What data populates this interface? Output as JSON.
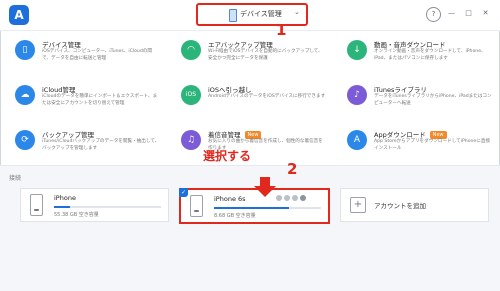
{
  "app": {
    "logo_letter": "A"
  },
  "header": {
    "device_selector_label": "デバイス管理"
  },
  "window_buttons": [
    "?",
    "—",
    "□",
    "✕"
  ],
  "annotations": {
    "step1": "1",
    "step2": "2",
    "select_text": "選択する"
  },
  "features": [
    {
      "title": "デバイス管理",
      "desc": "iOSデバイス、コンピューター、iTunes、iCloudの間で、データを自由に転送と管理",
      "icon": "phone-icon",
      "color": "#2b88e8"
    },
    {
      "title": "エアバックアップ管理",
      "desc": "Wi-Fi経由でiOSデバイスを自動的にバックアップして、安全かつ完全にデータを保護",
      "icon": "wifi-icon",
      "color": "#2cb57a"
    },
    {
      "title": "動画・音声ダウンロード",
      "desc": "オンライン動画・音声をダウンロードして、iPhone、iPad、またはパソコンに保存します",
      "icon": "download-icon",
      "color": "#2cb57a"
    },
    {
      "title": "iCloud管理",
      "desc": "iCloudのデータを簡単にインポート＆エクスポート、または安全にアカウントを切り替えて管理",
      "icon": "cloud-icon",
      "color": "#2b88e8"
    },
    {
      "title": "iOSへ引っ越し",
      "desc": "AndroidデバイスのデータをiOSデバイスに移行できます",
      "icon": "ios-icon",
      "color": "#2cb57a"
    },
    {
      "title": "iTunesライブラリ",
      "desc": "データをiTunesライブラリからiPhone、iPadまたはコンピューターへ転送",
      "icon": "music-note-icon",
      "color": "#7c5bd6"
    },
    {
      "title": "バックアップ管理",
      "desc": "iTunes/iCloudバックアップのデータを閲覧・抽出して、バックアップを管理します",
      "icon": "backup-icon",
      "color": "#2b88e8"
    },
    {
      "title": "着信音管理",
      "desc": "お気に入りの曲から着信音を作成し、個性的な着信音を作ります",
      "icon": "bell-icon",
      "color": "#7c5bd6",
      "badge": "New"
    },
    {
      "title": "Appダウンロード",
      "desc": "App StoreからアプリをダウンロードしてiPhoneに直接インストール",
      "icon": "app-store-icon",
      "color": "#2b88e8",
      "badge": "New"
    }
  ],
  "devices_section": {
    "label": "接続",
    "devices": [
      {
        "name": "iPhone",
        "storage": "55.38 GB 空き容量",
        "used_fraction": 0.15
      },
      {
        "name": "iPhone 6s",
        "storage": "8.68 GB 空き容量",
        "used_fraction": 0.7
      }
    ],
    "add_account": "アカウントを追加"
  },
  "colors": {
    "accent": "#1d6fd9",
    "annotation": "#e0281c"
  }
}
